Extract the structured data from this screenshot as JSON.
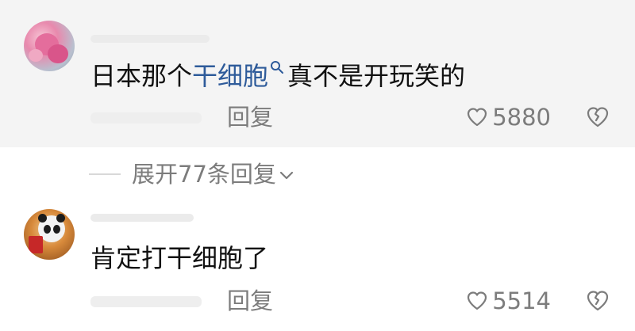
{
  "comments": [
    {
      "text_before": "日本那个",
      "highlight": "干细胞",
      "text_after": "真不是开玩笑的",
      "reply_label": "回复",
      "likes": "5880"
    },
    {
      "text": "肯定打干细胞了",
      "reply_label": "回复",
      "likes": "5514"
    }
  ],
  "expand": {
    "label": "展开77条回复"
  },
  "icons": {
    "search": "search-icon",
    "like": "heart-icon",
    "dislike": "broken-heart-icon",
    "expand": "chevron-down-icon"
  },
  "colors": {
    "highlight": "#2e5b9a",
    "meta_text": "#7c7c7c",
    "comment_bg": "#f4f4f4"
  }
}
